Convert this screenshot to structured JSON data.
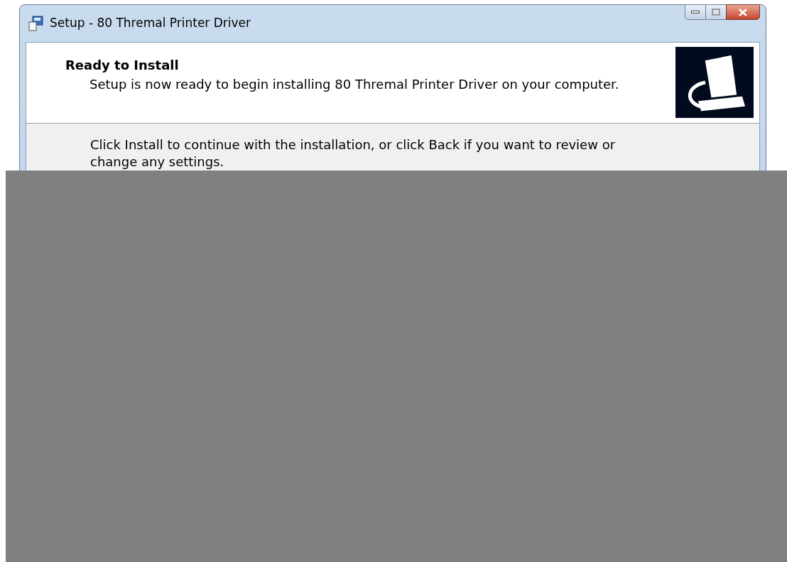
{
  "window": {
    "title": "Setup - 80 Thremal Printer Driver"
  },
  "header": {
    "title": "Ready to Install",
    "subtitle": "Setup is now ready to begin installing 80 Thremal Printer Driver on your computer."
  },
  "body": {
    "text": "Click Install to continue with the installation, or click Back if you want to review or change any settings."
  }
}
